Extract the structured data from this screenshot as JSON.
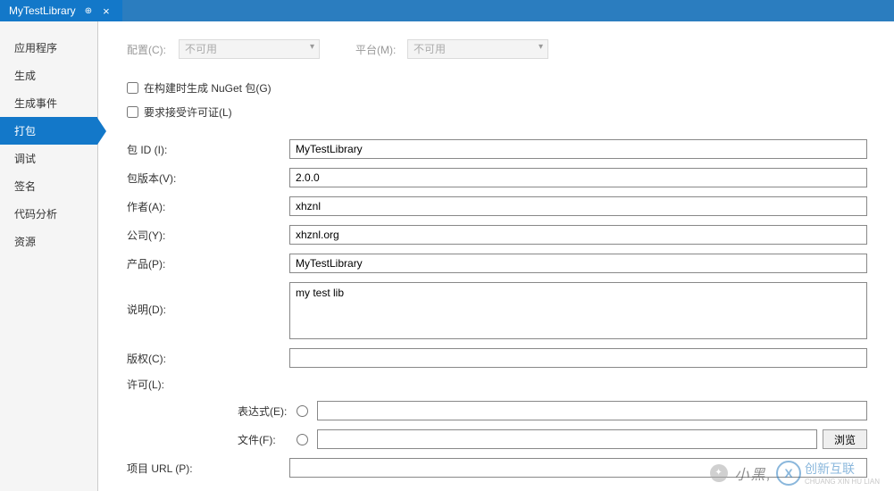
{
  "tab": {
    "title": "MyTestLibrary"
  },
  "sidebar": {
    "items": [
      {
        "label": "应用程序"
      },
      {
        "label": "生成"
      },
      {
        "label": "生成事件"
      },
      {
        "label": "打包"
      },
      {
        "label": "调试"
      },
      {
        "label": "签名"
      },
      {
        "label": "代码分析"
      },
      {
        "label": "资源"
      }
    ],
    "active_index": 3
  },
  "config": {
    "config_label": "配置(C):",
    "config_value": "不可用",
    "platform_label": "平台(M):",
    "platform_value": "不可用"
  },
  "checkboxes": {
    "generate_nuget": "在构建时生成 NuGet 包(G)",
    "require_license": "要求接受许可证(L)"
  },
  "form": {
    "package_id": {
      "label": "包 ID (I):",
      "value": "MyTestLibrary"
    },
    "package_version": {
      "label": "包版本(V):",
      "value": "2.0.0"
    },
    "authors": {
      "label": "作者(A):",
      "value": "xhznl"
    },
    "company": {
      "label": "公司(Y):",
      "value": "xhznl.org"
    },
    "product": {
      "label": "产品(P):",
      "value": "MyTestLibrary"
    },
    "description": {
      "label": "说明(D):",
      "value": "my test lib"
    },
    "copyright": {
      "label": "版权(C):",
      "value": ""
    },
    "license": {
      "label": "许可(L):",
      "value": ""
    },
    "expression": {
      "label": "表达式(E):",
      "value": ""
    },
    "file": {
      "label": "文件(F):",
      "value": "",
      "browse": "浏览"
    },
    "project_url": {
      "label": "项目 URL (P):",
      "value": ""
    }
  },
  "watermark": {
    "text1": "小黑,",
    "brand": "创新互联",
    "sub": "CHUANG XIN HU LIAN"
  }
}
